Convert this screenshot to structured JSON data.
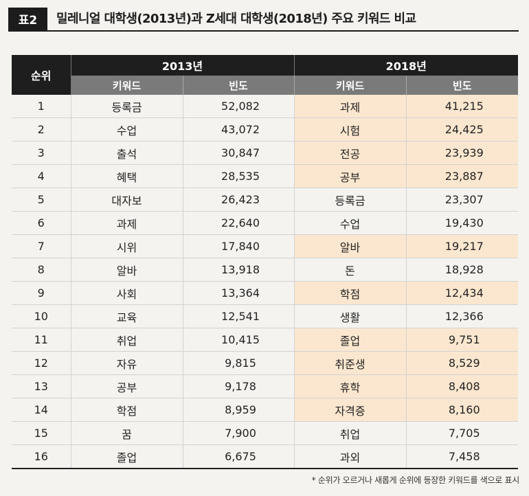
{
  "header": {
    "badge": "표2",
    "title": "밀레니얼 대학생(2013년)과 Z세대 대학생(2018년) 주요 키워드 비교"
  },
  "table": {
    "rank_header": "순위",
    "year_a": "2013년",
    "year_b": "2018년",
    "keyword_header": "키워드",
    "freq_header": "빈도",
    "highlight_color": "#fbe7cf",
    "rows": [
      {
        "rank": "1",
        "kw13": "등록금",
        "f13": "52,082",
        "kw18": "과제",
        "f18": "41,215",
        "hl": true
      },
      {
        "rank": "2",
        "kw13": "수업",
        "f13": "43,072",
        "kw18": "시험",
        "f18": "24,425",
        "hl": true
      },
      {
        "rank": "3",
        "kw13": "출석",
        "f13": "30,847",
        "kw18": "전공",
        "f18": "23,939",
        "hl": true
      },
      {
        "rank": "4",
        "kw13": "혜택",
        "f13": "28,535",
        "kw18": "공부",
        "f18": "23,887",
        "hl": true
      },
      {
        "rank": "5",
        "kw13": "대자보",
        "f13": "26,423",
        "kw18": "등록금",
        "f18": "23,307",
        "hl": false
      },
      {
        "rank": "6",
        "kw13": "과제",
        "f13": "22,640",
        "kw18": "수업",
        "f18": "19,430",
        "hl": false
      },
      {
        "rank": "7",
        "kw13": "시위",
        "f13": "17,840",
        "kw18": "알바",
        "f18": "19,217",
        "hl": true
      },
      {
        "rank": "8",
        "kw13": "알바",
        "f13": "13,918",
        "kw18": "돈",
        "f18": "18,928",
        "hl": false
      },
      {
        "rank": "9",
        "kw13": "사회",
        "f13": "13,364",
        "kw18": "학점",
        "f18": "12,434",
        "hl": true
      },
      {
        "rank": "10",
        "kw13": "교육",
        "f13": "12,541",
        "kw18": "생활",
        "f18": "12,366",
        "hl": false
      },
      {
        "rank": "11",
        "kw13": "취업",
        "f13": "10,415",
        "kw18": "졸업",
        "f18": "9,751",
        "hl": true
      },
      {
        "rank": "12",
        "kw13": "자유",
        "f13": "9,815",
        "kw18": "취준생",
        "f18": "8,529",
        "hl": true
      },
      {
        "rank": "13",
        "kw13": "공부",
        "f13": "9,178",
        "kw18": "휴학",
        "f18": "8,408",
        "hl": true
      },
      {
        "rank": "14",
        "kw13": "학점",
        "f13": "8,959",
        "kw18": "자격증",
        "f18": "8,160",
        "hl": true
      },
      {
        "rank": "15",
        "kw13": "꿈",
        "f13": "7,900",
        "kw18": "취업",
        "f18": "7,705",
        "hl": false
      },
      {
        "rank": "16",
        "kw13": "졸업",
        "f13": "6,675",
        "kw18": "과외",
        "f18": "7,458",
        "hl": false
      }
    ]
  },
  "footnote": "* 순위가 오르거나 새롭게 순위에 등장한 키워드를 색으로 표시"
}
